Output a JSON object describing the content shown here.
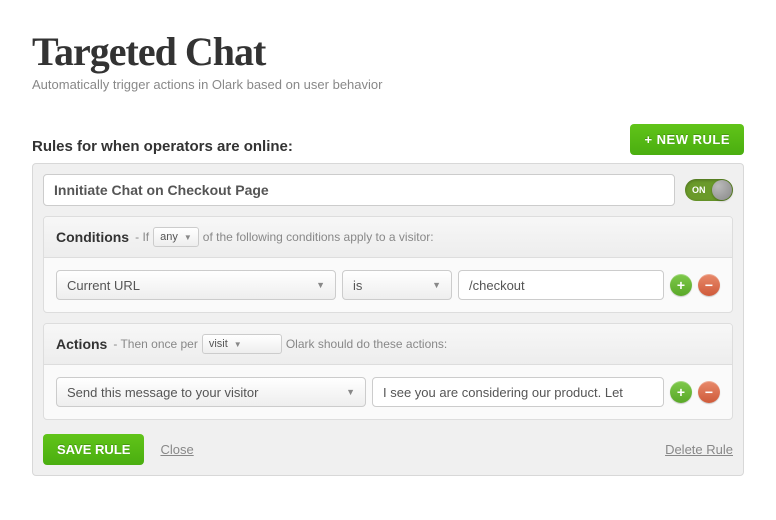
{
  "page": {
    "title": "Targeted Chat",
    "subtitle": "Automatically trigger actions in Olark based on user behavior",
    "rules_label": "Rules for when operators are online:",
    "new_rule_label": "+ NEW RULE"
  },
  "rule": {
    "name": "Innitiate Chat on Checkout Page",
    "toggle_state": "ON"
  },
  "conditions": {
    "title": "Conditions",
    "prefix": "- If",
    "match_mode": "any",
    "suffix": "of the following conditions apply to a visitor:",
    "rows": [
      {
        "field": "Current URL",
        "operator": "is",
        "value": "/checkout"
      }
    ]
  },
  "actions": {
    "title": "Actions",
    "prefix": "- Then once per",
    "frequency": "visit",
    "suffix": "Olark should do these actions:",
    "rows": [
      {
        "action": "Send this message to your visitor",
        "value": "I see you are considering our product. Let"
      }
    ]
  },
  "footer": {
    "save": "SAVE RULE",
    "close": "Close",
    "delete": "Delete Rule"
  },
  "icons": {
    "add": "+",
    "remove": "−"
  }
}
